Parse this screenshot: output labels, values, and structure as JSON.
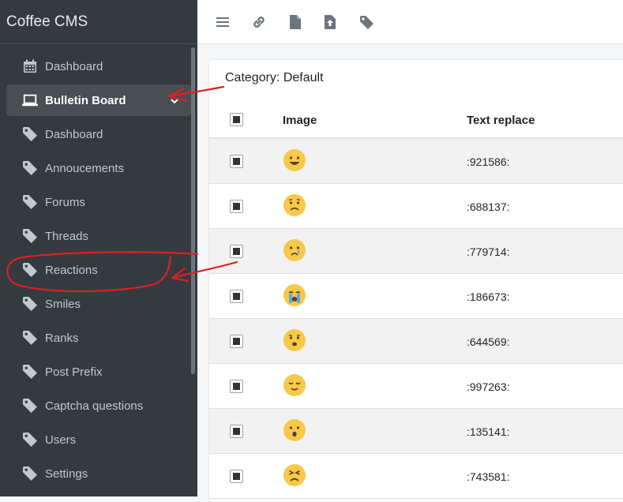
{
  "sidebar": {
    "brand": "Coffee CMS",
    "items": [
      {
        "label": "Dashboard",
        "icon": "calendar-icon",
        "active": false
      },
      {
        "label": "Bulletin Board",
        "icon": "laptop-icon",
        "active": true
      },
      {
        "label": "Dashboard",
        "icon": "tag-icon",
        "active": false
      },
      {
        "label": "Annoucements",
        "icon": "tag-icon",
        "active": false
      },
      {
        "label": "Forums",
        "icon": "tag-icon",
        "active": false
      },
      {
        "label": "Threads",
        "icon": "tag-icon",
        "active": false
      },
      {
        "label": "Reactions",
        "icon": "tag-icon",
        "active": false
      },
      {
        "label": "Smiles",
        "icon": "tag-icon",
        "active": false
      },
      {
        "label": "Ranks",
        "icon": "tag-icon",
        "active": false
      },
      {
        "label": "Post Prefix",
        "icon": "tag-icon",
        "active": false
      },
      {
        "label": "Captcha questions",
        "icon": "tag-icon",
        "active": false
      },
      {
        "label": "Users",
        "icon": "tag-icon",
        "active": false
      },
      {
        "label": "Settings",
        "icon": "tag-icon",
        "active": false
      }
    ]
  },
  "toolbar": {
    "icons": [
      "menu-icon",
      "link-icon",
      "file-icon",
      "file-upload-icon",
      "tag-icon"
    ]
  },
  "main": {
    "category_label": "Category: Default",
    "columns": {
      "image": "Image",
      "text_replace": "Text replace"
    },
    "rows": [
      {
        "emoji": "grinning",
        "code": ":921586:"
      },
      {
        "emoji": "frowning",
        "code": ":688137:"
      },
      {
        "emoji": "crying",
        "code": ":779714:"
      },
      {
        "emoji": "sobbing",
        "code": ":186673:"
      },
      {
        "emoji": "worried",
        "code": ":644569:"
      },
      {
        "emoji": "relieved",
        "code": ":997263:"
      },
      {
        "emoji": "surprised",
        "code": ":135141:"
      },
      {
        "emoji": "angry",
        "code": ":743581:"
      }
    ]
  },
  "colors": {
    "sidebar_bg": "#343a40",
    "sidebar_active": "#494e53",
    "annotation_red": "#e0201e",
    "emoji_yellow": "#f7c948"
  }
}
